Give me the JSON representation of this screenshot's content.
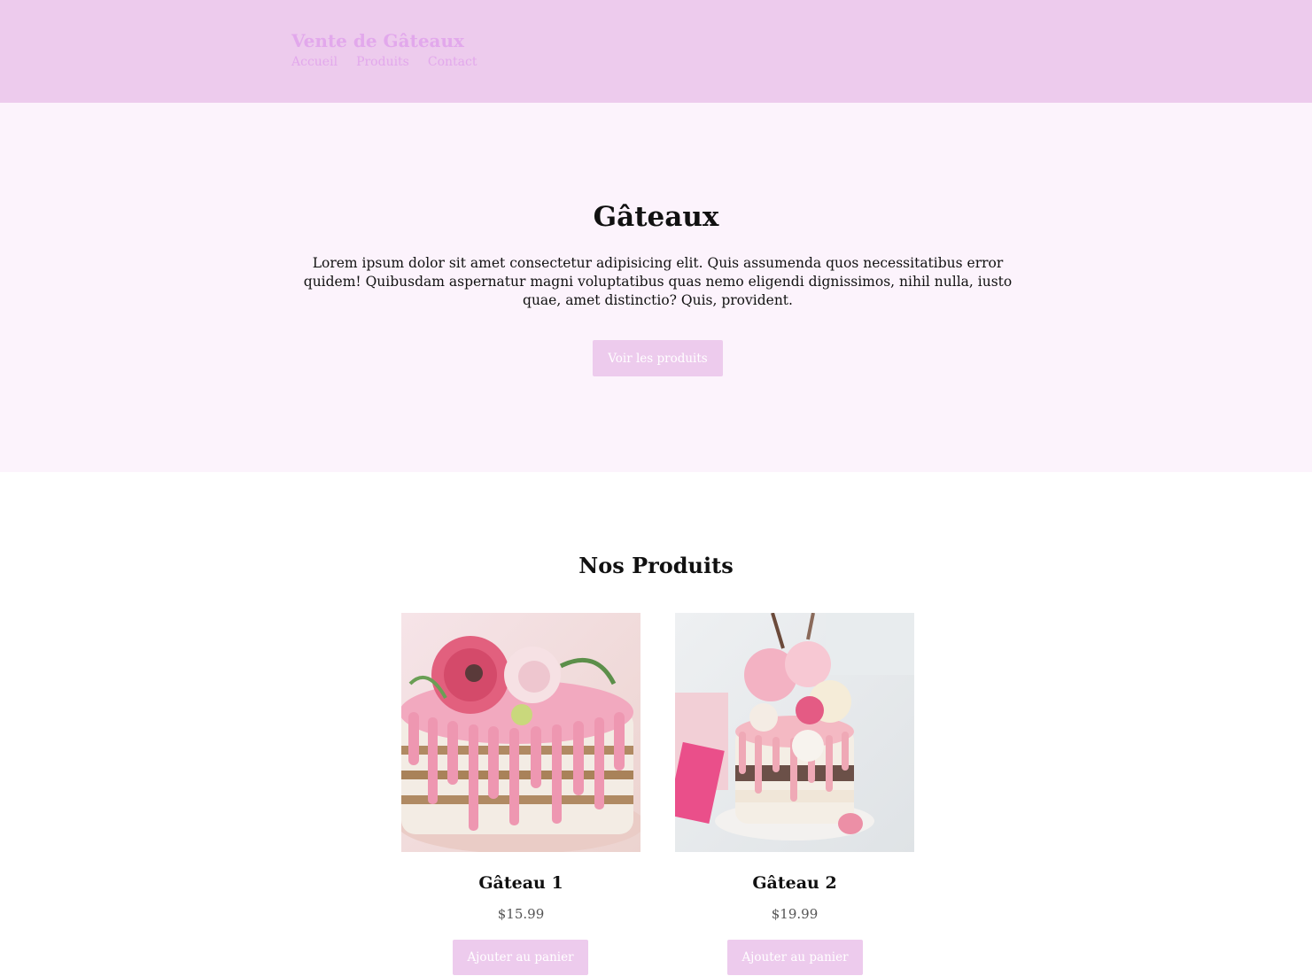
{
  "header": {
    "brand": "Vente de Gâteaux",
    "nav": [
      {
        "label": "Accueil"
      },
      {
        "label": "Produits"
      },
      {
        "label": "Contact"
      }
    ]
  },
  "hero": {
    "title": "Gâteaux",
    "text": "Lorem ipsum dolor sit amet consectetur adipisicing elit. Quis assumenda quos necessitatibus error quidem! Quibusdam aspernatur magni voluptatibus quas nemo eligendi dignissimos, nihil nulla, iusto quae, amet distinctio? Quis, provident.",
    "button_label": "Voir les produits"
  },
  "products": {
    "title": "Nos Produits",
    "items": [
      {
        "name": "Gâteau 1",
        "price": "$15.99",
        "button_label": "Ajouter au panier"
      },
      {
        "name": "Gâteau 2",
        "price": "$19.99",
        "button_label": "Ajouter au panier"
      }
    ]
  },
  "colors": {
    "header_bg": "#edcbed",
    "brand_text": "#e2a8ec",
    "hero_bg": "#fcf3fc",
    "button_bg": "#edcbed"
  }
}
